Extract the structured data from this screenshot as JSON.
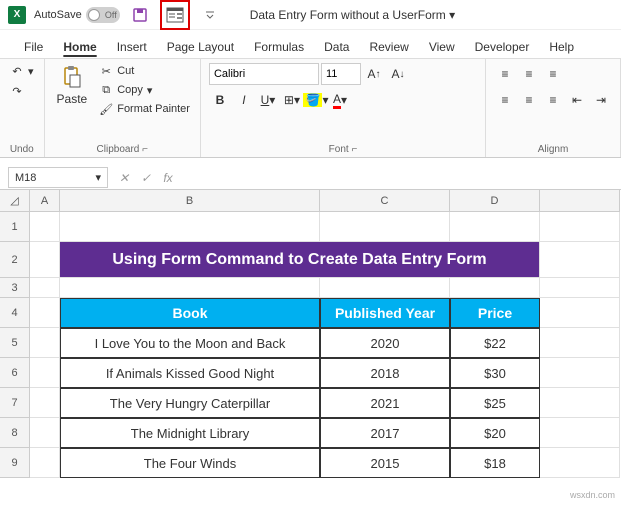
{
  "titlebar": {
    "autosave_label": "AutoSave",
    "autosave_state": "Off",
    "document_title": "Data Entry Form without a UserForm ▾"
  },
  "menu": [
    "File",
    "Home",
    "Insert",
    "Page Layout",
    "Formulas",
    "Data",
    "Review",
    "View",
    "Developer",
    "Help"
  ],
  "menu_active": "Home",
  "ribbon": {
    "undo_label": "Undo",
    "clipboard": {
      "paste_label": "Paste",
      "cut_label": "Cut",
      "copy_label": "Copy",
      "format_painter_label": "Format Painter",
      "group_label": "Clipboard"
    },
    "font": {
      "font_name": "Calibri",
      "font_size": "11",
      "group_label": "Font"
    },
    "alignment": {
      "group_label": "Alignm"
    }
  },
  "formula_bar": {
    "name_box": "M18",
    "fx_label": "fx",
    "formula_value": ""
  },
  "columns": [
    "A",
    "B",
    "C",
    "D"
  ],
  "rows": [
    "1",
    "2",
    "3",
    "4",
    "5",
    "6",
    "7",
    "8",
    "9"
  ],
  "sheet_title": "Using Form Command to Create Data Entry Form",
  "table": {
    "headers": [
      "Book",
      "Published Year",
      "Price"
    ],
    "data": [
      [
        "I Love You to the Moon and Back",
        "2020",
        "$22"
      ],
      [
        "If Animals Kissed Good Night",
        "2018",
        "$30"
      ],
      [
        "The Very Hungry Caterpillar",
        "2021",
        "$25"
      ],
      [
        "The Midnight Library",
        "2017",
        "$20"
      ],
      [
        "The Four Winds",
        "2015",
        "$18"
      ]
    ]
  },
  "watermark": "wsxdn.com"
}
